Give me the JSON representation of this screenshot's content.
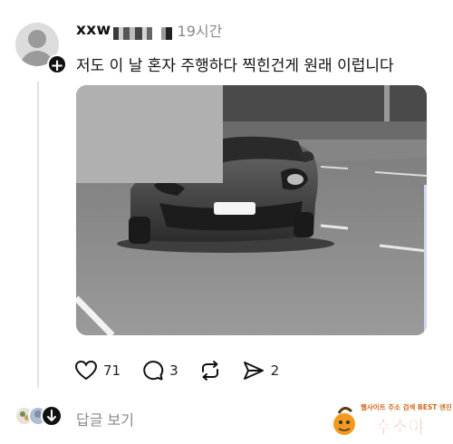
{
  "post": {
    "username": "xxw",
    "timestamp": "19시간",
    "text": "저도 이 날 혼자 주행하다 찍힌건게 원래 이럽니다",
    "follow_icon": "plus-icon"
  },
  "actions": {
    "likes": "71",
    "comments": "3",
    "shares": "2"
  },
  "replies": {
    "label": "답글 보기"
  },
  "watermark": {
    "top_text": "웹사이트 주소 검색 BEST 엔진",
    "brand": "주소야"
  },
  "colors": {
    "text": "#111111",
    "muted": "#8a8a8a",
    "thread_line": "#e2e2e2"
  }
}
